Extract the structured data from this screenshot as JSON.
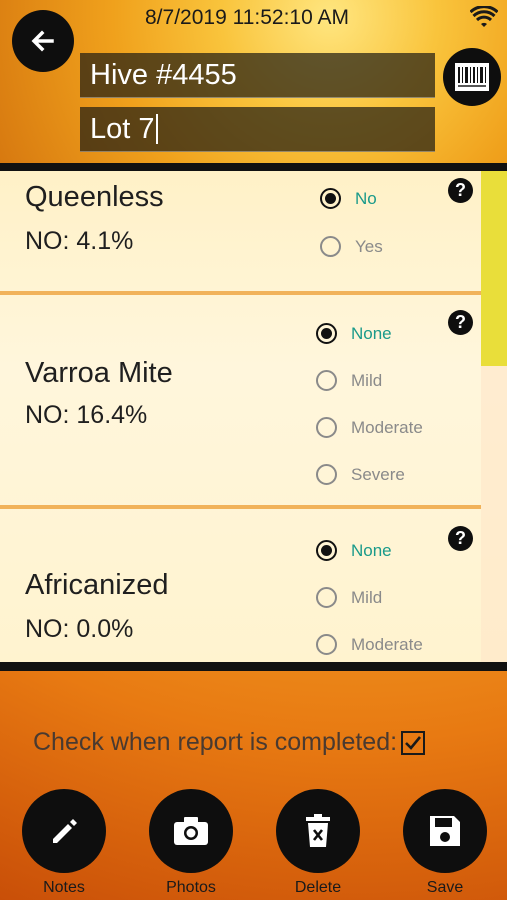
{
  "header": {
    "timestamp": "8/7/2019 11:52:10 AM",
    "hive_value": "Hive #4455",
    "lot_value": "Lot 7"
  },
  "cards": [
    {
      "title": "Queenless",
      "stat": "NO: 4.1%",
      "options": [
        {
          "label": "No",
          "selected": true
        },
        {
          "label": "Yes",
          "selected": false
        }
      ]
    },
    {
      "title": "Varroa Mite",
      "stat": "NO: 16.4%",
      "options": [
        {
          "label": "None",
          "selected": true
        },
        {
          "label": "Mild",
          "selected": false
        },
        {
          "label": "Moderate",
          "selected": false
        },
        {
          "label": "Severe",
          "selected": false
        }
      ]
    },
    {
      "title": "Africanized",
      "stat": "NO: 0.0%",
      "options": [
        {
          "label": "None",
          "selected": true
        },
        {
          "label": "Mild",
          "selected": false
        },
        {
          "label": "Moderate",
          "selected": false
        }
      ]
    }
  ],
  "help_glyph": "?",
  "completion": {
    "label": "Check when report is completed:",
    "checked": true
  },
  "actions": [
    {
      "label": "Notes",
      "icon": "pencil-icon"
    },
    {
      "label": "Photos",
      "icon": "camera-icon"
    },
    {
      "label": "Delete",
      "icon": "trash-icon"
    },
    {
      "label": "Save",
      "icon": "floppy-disk-icon"
    }
  ],
  "colors": {
    "selected_label": "#1a9a8a",
    "scrollbar": "#e9de3a"
  }
}
